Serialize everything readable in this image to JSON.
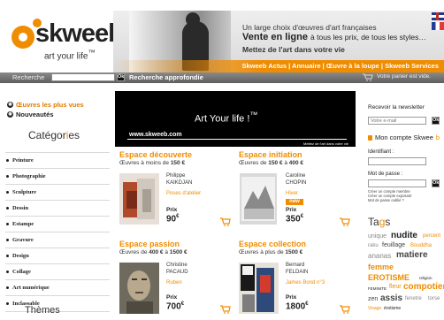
{
  "header": {
    "logo_text": "skweeb",
    "logo_tagline": "art your life",
    "logo_tm": "™",
    "banner_line1": "Un large choix d'œuvres d'art françaises",
    "banner_line2_bold": "Vente en ligne",
    "banner_line2_rest": "à tous les prix, de tous les styles…",
    "banner_line3": "Mettez de l'art dans votre vie",
    "banner_links": "Skweeb Actus | Annuaire | Œuvre à la loupe | Skweeb Services"
  },
  "searchbar": {
    "label": "Recherche",
    "input_value": "",
    "ok_label": "Ok",
    "advanced_label": "Recherche approfondie",
    "cart_text": "Votre panier est vide."
  },
  "sidebar": {
    "link_popular": "Œuvres les plus vues",
    "link_new": "Nouveautés",
    "categories_title_pre": "Catégor",
    "categories_title_hl": "i",
    "categories_title_post": "es",
    "categories": [
      "Peinture",
      "Photographie",
      "Sculpture",
      "Dessin",
      "Estampe",
      "Gravure",
      "Design",
      "Collage",
      "Art numérique",
      "Inclassable"
    ],
    "themes_title": "Thèmes"
  },
  "hero": {
    "title": "Art  Your life !",
    "title_mark": "™",
    "url": "www.skweeb.com",
    "tagline": "Mettez de l'art dans votre vie"
  },
  "cards": [
    {
      "title": "Espace découverte",
      "sub_pre": "Œuvres à moins de ",
      "sub_amount": "150 €",
      "sub_post": "",
      "artist_first": "Philippe",
      "artist_last": "KAIKDJAN",
      "work": "Poses d'atelier",
      "prix_label": "Prix",
      "price": "90",
      "currency": "€",
      "new": ""
    },
    {
      "title": "Espace initiation",
      "sub_pre": "Œuvres de ",
      "sub_amount": "150 €",
      "sub_mid": " à ",
      "sub_amount2": "400 €",
      "artist_first": "Caroline",
      "artist_last": "CHOPIN",
      "work": "Hiver",
      "prix_label": "Prix",
      "price": "350",
      "currency": "€",
      "new": "new"
    },
    {
      "title": "Espace passion",
      "sub_pre": "Œuvres de ",
      "sub_amount": "400 €",
      "sub_mid": " à ",
      "sub_amount2": "1500 €",
      "artist_first": "Christine",
      "artist_last": "PACAUD",
      "work": "Ruben",
      "prix_label": "Prix",
      "price": "700",
      "currency": "€",
      "new": ""
    },
    {
      "title": "Espace collection",
      "sub_pre": "Œuvres à plus de ",
      "sub_amount": "1500 €",
      "sub_post": "",
      "artist_first": "Bernard",
      "artist_last": "FELDAIN",
      "work": "James Bond n°3",
      "prix_label": "Prix",
      "price": "1800",
      "currency": "€",
      "new": ""
    }
  ],
  "right": {
    "newsletter_label": "Recevoir la newsletter",
    "newsletter_placeholder": "Votre e-mail",
    "ok_label": "Ok",
    "account_pre": "Mon compte Skwee",
    "account_hl": "b",
    "id_label": "Identifiant :",
    "pass_label": "Mot de passe :",
    "create_buyer": "Créer un compte membre",
    "create_exhibitor": "Créer un compte exposant",
    "forgot": "Mot de passe oublié ?",
    "tags_title_pre": "Ta",
    "tags_title_hl": "g",
    "tags_title_post": "s",
    "tags": [
      "unique",
      "nudite",
      "percent",
      "raku",
      "feuillage",
      "Bouddha",
      "ananas",
      "matiere",
      "femme",
      "EROTISME",
      "religion",
      "FEMINITE",
      "fleur",
      "compotier",
      "zen",
      "assis",
      "fenetre",
      "torse",
      "Visage",
      "érotisme"
    ]
  },
  "colors": {
    "accent": "#f08c00",
    "dark": "#222222",
    "hero_bg": "#000000",
    "searchbar": "#6e6e6e"
  }
}
